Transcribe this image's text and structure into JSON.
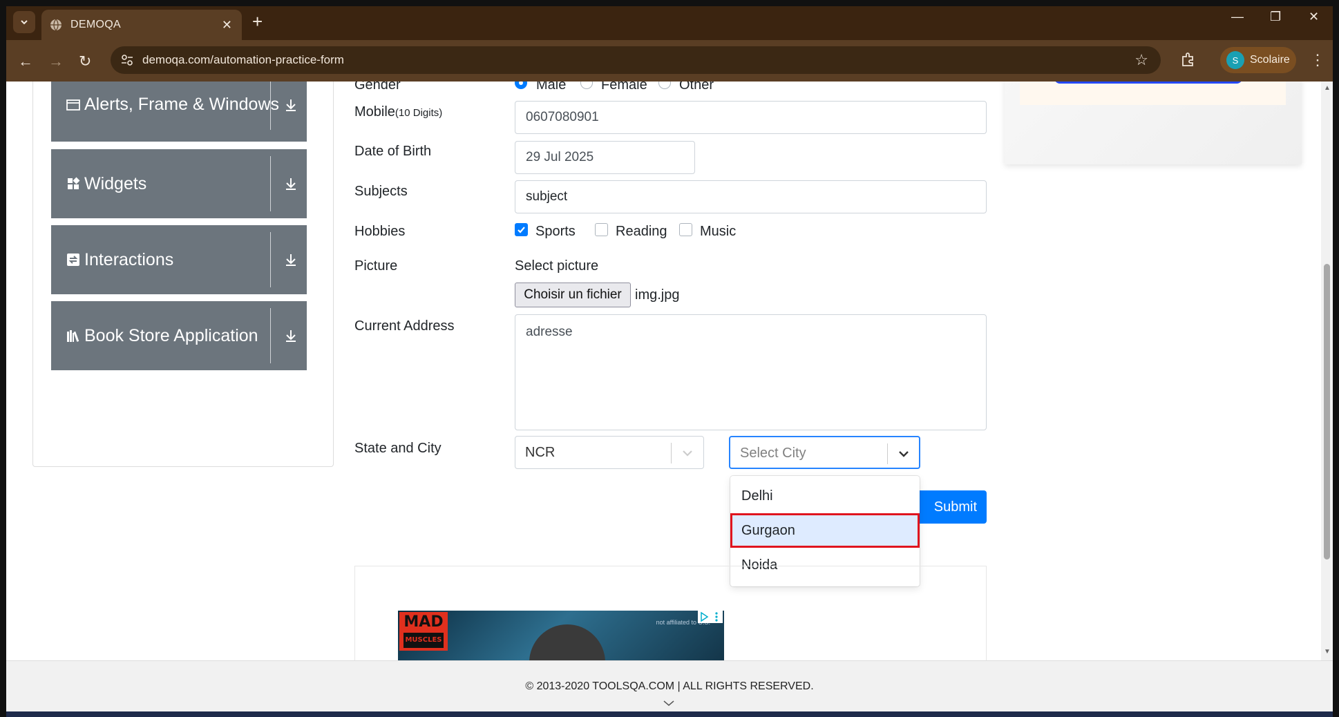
{
  "browser": {
    "tab_title": "DEMOQA",
    "url": "demoqa.com/automation-practice-form",
    "profile_initial": "S",
    "profile_name": "Scolaire",
    "new_tab": "+",
    "close_tab": "✕"
  },
  "sidebar": {
    "groups": [
      {
        "label": "Alerts, Frame & Windows",
        "icon": "window-icon"
      },
      {
        "label": "Widgets",
        "icon": "widgets-icon"
      },
      {
        "label": "Interactions",
        "icon": "interactions-icon"
      },
      {
        "label": "Book Store Application",
        "icon": "books-icon"
      }
    ]
  },
  "form": {
    "gender_label": "Gender",
    "gender_options": [
      "Male",
      "Female",
      "Other"
    ],
    "gender_selected": "Male",
    "mobile_label": "Mobile",
    "mobile_hint": "(10 Digits)",
    "mobile_value": "0607080901",
    "dob_label": "Date of Birth",
    "dob_value": "29 Jul 2025",
    "subjects_label": "Subjects",
    "subjects_value": "subject",
    "hobbies_label": "Hobbies",
    "hobbies": [
      {
        "label": "Sports",
        "checked": true
      },
      {
        "label": "Reading",
        "checked": false
      },
      {
        "label": "Music",
        "checked": false
      }
    ],
    "picture_label": "Picture",
    "picture_hint": "Select picture",
    "file_button": "Choisir un fichier",
    "file_name": "img.jpg",
    "address_label": "Current Address",
    "address_value": "adresse",
    "state_city_label": "State and City",
    "state_value": "NCR",
    "city_placeholder": "Select City",
    "city_options": [
      "Delhi",
      "Gurgaon",
      "Noida"
    ],
    "city_highlighted": "Gurgaon",
    "submit_label": "Submit"
  },
  "ad": {
    "brand": "MAD",
    "brand_sub": "MUSCLES",
    "disclaimer": "not affiliated to U.S."
  },
  "footer": {
    "copyright": "© 2013-2020 TOOLSQA.COM | ALL RIGHTS RESERVED."
  },
  "colors": {
    "primary": "#007bff",
    "sidebar_group": "#6c757d",
    "highlight_border": "#e0141e",
    "option_highlight": "#deebff",
    "chrome_dark": "#3b2410",
    "chrome_toolbar": "#5a3e24"
  }
}
